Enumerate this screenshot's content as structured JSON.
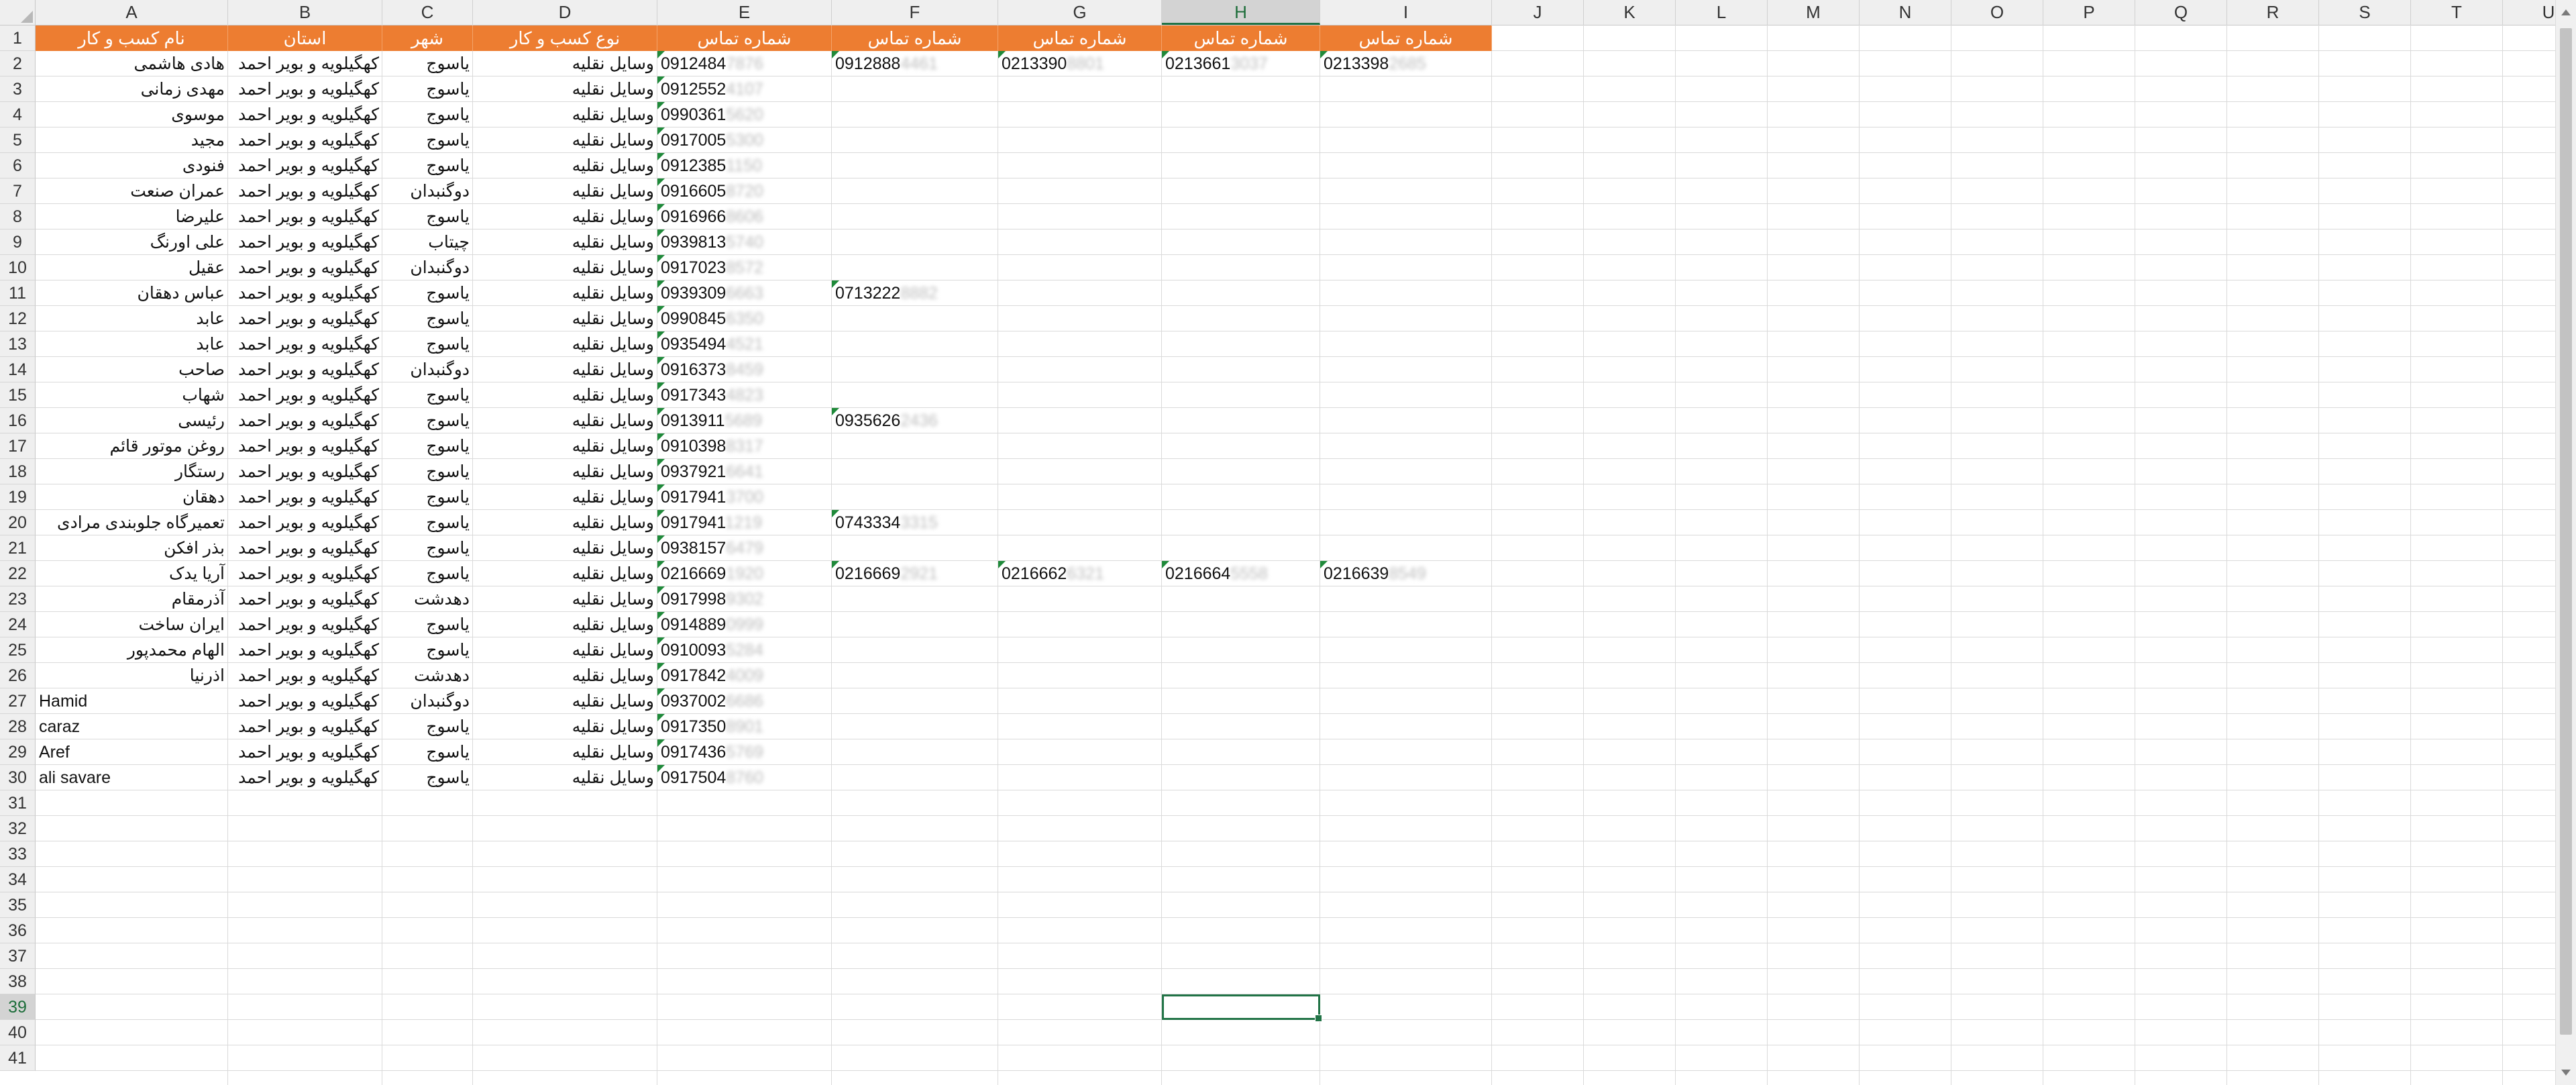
{
  "columns": [
    "A",
    "B",
    "C",
    "D",
    "E",
    "F",
    "G",
    "H",
    "I",
    "J",
    "K",
    "L",
    "M",
    "N",
    "O",
    "P",
    "Q",
    "R",
    "S",
    "T",
    "U"
  ],
  "active_column": "H",
  "active_row": "39",
  "row_numbers": [
    "1",
    "2",
    "3",
    "4",
    "5",
    "6",
    "7",
    "8",
    "9",
    "10",
    "11",
    "12",
    "13",
    "14",
    "15",
    "16",
    "17",
    "18",
    "19",
    "20",
    "21",
    "22",
    "23",
    "24",
    "25",
    "26",
    "27",
    "28",
    "29",
    "30",
    "31",
    "32",
    "33",
    "34",
    "35",
    "36",
    "37",
    "38",
    "39",
    "40",
    "41"
  ],
  "header_row": [
    "نام کسب و کار",
    "استان",
    "شهر",
    "نوع کسب و کار",
    "شماره تماس",
    "شماره تماس",
    "شماره تماس",
    "شماره تماس",
    "شماره تماس"
  ],
  "header_fill_color": "#ed7d31",
  "records": [
    {
      "name": "هادی هاشمی",
      "province": "کهگیلویه و بویر احمد",
      "city": "یاسوج",
      "type": "وسایل نقلیه",
      "phones": [
        [
          "0912484",
          "7876"
        ],
        [
          "0912888",
          "4461"
        ],
        [
          "0213390",
          "8801"
        ],
        [
          "0213661",
          "3037"
        ],
        [
          "0213398",
          "2685"
        ]
      ]
    },
    {
      "name": "مهدی زمانی",
      "province": "کهگیلویه و بویر احمد",
      "city": "یاسوج",
      "type": "وسایل نقلیه",
      "phones": [
        [
          "0912552",
          "4107"
        ]
      ]
    },
    {
      "name": "موسوی",
      "province": "کهگیلویه و بویر احمد",
      "city": "یاسوج",
      "type": "وسایل نقلیه",
      "phones": [
        [
          "0990361",
          "5620"
        ]
      ]
    },
    {
      "name": "مجید",
      "province": "کهگیلویه و بویر احمد",
      "city": "یاسوج",
      "type": "وسایل نقلیه",
      "phones": [
        [
          "0917005",
          "5300"
        ]
      ]
    },
    {
      "name": "فنودی",
      "province": "کهگیلویه و بویر احمد",
      "city": "یاسوج",
      "type": "وسایل نقلیه",
      "phones": [
        [
          "0912385",
          "1150"
        ]
      ]
    },
    {
      "name": "عمران صنعت",
      "province": "کهگیلویه و بویر احمد",
      "city": "دوگنبدان",
      "type": "وسایل نقلیه",
      "phones": [
        [
          "0916605",
          "8720"
        ]
      ]
    },
    {
      "name": "علیرضا",
      "province": "کهگیلویه و بویر احمد",
      "city": "یاسوج",
      "type": "وسایل نقلیه",
      "phones": [
        [
          "0916966",
          "8606"
        ]
      ]
    },
    {
      "name": "علی اورنگ",
      "province": "کهگیلویه و بویر احمد",
      "city": "چیتاب",
      "type": "وسایل نقلیه",
      "phones": [
        [
          "0939813",
          "5740"
        ]
      ]
    },
    {
      "name": "عقیل",
      "province": "کهگیلویه و بویر احمد",
      "city": "دوگنبدان",
      "type": "وسایل نقلیه",
      "phones": [
        [
          "0917023",
          "8572"
        ]
      ]
    },
    {
      "name": "عباس دهقان",
      "province": "کهگیلویه و بویر احمد",
      "city": "یاسوج",
      "type": "وسایل نقلیه",
      "phones": [
        [
          "0939309",
          "6663"
        ],
        [
          "0713222",
          "8882"
        ]
      ]
    },
    {
      "name": "عابد",
      "province": "کهگیلویه و بویر احمد",
      "city": "یاسوج",
      "type": "وسایل نقلیه",
      "phones": [
        [
          "0990845",
          "6350"
        ]
      ]
    },
    {
      "name": "عابد",
      "province": "کهگیلویه و بویر احمد",
      "city": "یاسوج",
      "type": "وسایل نقلیه",
      "phones": [
        [
          "0935494",
          "4521"
        ]
      ]
    },
    {
      "name": "صاحب",
      "province": "کهگیلویه و بویر احمد",
      "city": "دوگنبدان",
      "type": "وسایل نقلیه",
      "phones": [
        [
          "0916373",
          "8459"
        ]
      ]
    },
    {
      "name": "شهاب",
      "province": "کهگیلویه و بویر احمد",
      "city": "یاسوج",
      "type": "وسایل نقلیه",
      "phones": [
        [
          "0917343",
          "4823"
        ]
      ]
    },
    {
      "name": "رئیسی",
      "province": "کهگیلویه و بویر احمد",
      "city": "یاسوج",
      "type": "وسایل نقلیه",
      "phones": [
        [
          "0913911",
          "5689"
        ],
        [
          "0935626",
          "2436"
        ]
      ]
    },
    {
      "name": "روغن موتور قائم",
      "province": "کهگیلویه و بویر احمد",
      "city": "یاسوج",
      "type": "وسایل نقلیه",
      "phones": [
        [
          "0910398",
          "8317"
        ]
      ]
    },
    {
      "name": "رستگار",
      "province": "کهگیلویه و بویر احمد",
      "city": "یاسوج",
      "type": "وسایل نقلیه",
      "phones": [
        [
          "0937921",
          "6641"
        ]
      ]
    },
    {
      "name": "دهقان",
      "province": "کهگیلویه و بویر احمد",
      "city": "یاسوج",
      "type": "وسایل نقلیه",
      "phones": [
        [
          "0917941",
          "3700"
        ]
      ]
    },
    {
      "name": "تعمیرگاه جلوبندی مرادی",
      "province": "کهگیلویه و بویر احمد",
      "city": "یاسوج",
      "type": "وسایل نقلیه",
      "phones": [
        [
          "0917941",
          "1219"
        ],
        [
          "0743334",
          "3315"
        ]
      ]
    },
    {
      "name": "بذر افکن",
      "province": "کهگیلویه و بویر احمد",
      "city": "یاسوج",
      "type": "وسایل نقلیه",
      "phones": [
        [
          "0938157",
          "6479"
        ]
      ]
    },
    {
      "name": "آریا یدک",
      "province": "کهگیلویه و بویر احمد",
      "city": "یاسوج",
      "type": "وسایل نقلیه",
      "phones": [
        [
          "0216669",
          "1920"
        ],
        [
          "0216669",
          "2921"
        ],
        [
          "0216662",
          "6321"
        ],
        [
          "0216664",
          "5558"
        ],
        [
          "0216639",
          "8549"
        ]
      ]
    },
    {
      "name": "آذرمقام",
      "province": "کهگیلویه و بویر احمد",
      "city": "دهدشت",
      "type": "وسایل نقلیه",
      "phones": [
        [
          "0917998",
          "9302"
        ]
      ]
    },
    {
      "name": "ایران ساخت",
      "province": "کهگیلویه و بویر احمد",
      "city": "یاسوج",
      "type": "وسایل نقلیه",
      "phones": [
        [
          "0914889",
          "0999"
        ]
      ]
    },
    {
      "name": "الهام محمدپور",
      "province": "کهگیلویه و بویر احمد",
      "city": "یاسوج",
      "type": "وسایل نقلیه",
      "phones": [
        [
          "0910093",
          "5284"
        ]
      ]
    },
    {
      "name": "اذرنیا",
      "province": "کهگیلویه و بویر احمد",
      "city": "دهدشت",
      "type": "وسایل نقلیه",
      "phones": [
        [
          "0917842",
          "4009"
        ]
      ]
    },
    {
      "name": "Hamid",
      "province": "کهگیلویه و بویر احمد",
      "city": "دوگنبدان",
      "type": "وسایل نقلیه",
      "phones": [
        [
          "0937002",
          "6686"
        ]
      ]
    },
    {
      "name": "caraz",
      "province": "کهگیلویه و بویر احمد",
      "city": "یاسوج",
      "type": "وسایل نقلیه",
      "phones": [
        [
          "0917350",
          "8901"
        ]
      ]
    },
    {
      "name": "Aref",
      "province": "کهگیلویه و بویر احمد",
      "city": "یاسوج",
      "type": "وسایل نقلیه",
      "phones": [
        [
          "0917436",
          "5769"
        ]
      ]
    },
    {
      "name": "ali savare",
      "province": "کهگیلویه و بویر احمد",
      "city": "یاسوج",
      "type": "وسایل نقلیه",
      "phones": [
        [
          "0917504",
          "8760"
        ]
      ]
    }
  ]
}
